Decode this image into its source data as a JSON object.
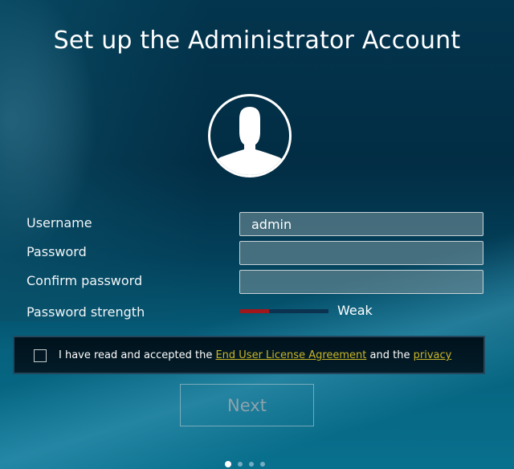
{
  "page": {
    "title": "Set up the Administrator Account"
  },
  "form": {
    "username": {
      "label": "Username",
      "value": "admin"
    },
    "password": {
      "label": "Password",
      "value": ""
    },
    "confirm_password": {
      "label": "Confirm password",
      "value": ""
    },
    "strength": {
      "label": "Password strength",
      "value": "Weak",
      "level_fraction": 0.33,
      "color": "#a0161a"
    }
  },
  "eula": {
    "checked": false,
    "prefix": "I have read and accepted the ",
    "eula_link": "End User License Agreement",
    "middle": " and the ",
    "privacy_link": "privacy"
  },
  "actions": {
    "next_label": "Next"
  },
  "pagination": {
    "current_step": 1,
    "total_steps": 4
  },
  "icons": {
    "avatar": "user-avatar-icon"
  }
}
